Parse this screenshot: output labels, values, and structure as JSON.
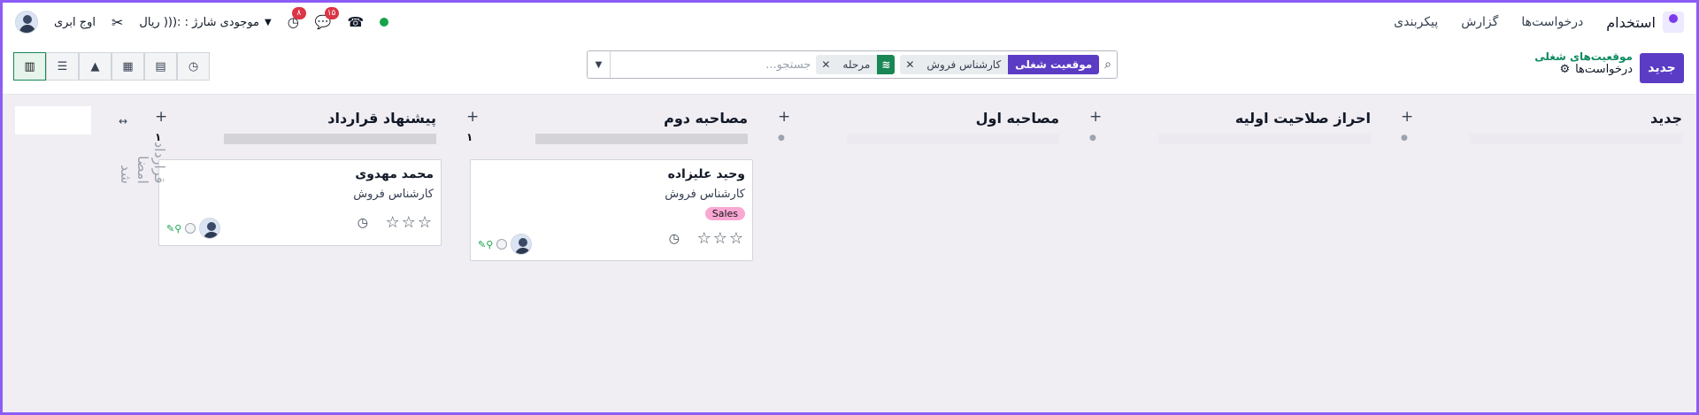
{
  "nav": {
    "app_name": "استخدام",
    "menu": [
      "درخواست‌ها",
      "گزارش",
      "پیکربندی"
    ],
    "user_name": "اوج ابری",
    "credit_label": "موجودی شارژ : :((( ریال",
    "activity_badge": "۸",
    "messages_badge": "۱۵",
    "status_color": "#16a34a"
  },
  "control": {
    "new_button": "جدید",
    "breadcrumb_parent": "موقعیت‌های شغلی",
    "breadcrumb_current": "درخواست‌ها",
    "search": {
      "placeholder": "جستجو...",
      "facets": [
        {
          "label": "موقعیت شغلی",
          "value": "کارشناس فروش"
        },
        {
          "label": "stack-icon",
          "value": "مرحله"
        }
      ]
    },
    "views": [
      "kanban",
      "list",
      "graph",
      "calendar",
      "pivot",
      "activity"
    ]
  },
  "columns": [
    {
      "title": "جدید",
      "count": "0"
    },
    {
      "title": "احراز صلاحیت اولیه",
      "count": "0"
    },
    {
      "title": "مصاحبه اول",
      "count": "0"
    },
    {
      "title": "مصاحبه دوم",
      "count": "۱"
    },
    {
      "title": "پیشنهاد قرارداد",
      "count": "۱"
    }
  ],
  "folded_column": "قرارداد امضا شد",
  "cards": [
    {
      "name": "وحید علیزاده",
      "job": "کارشناس فروش",
      "tag": "Sales",
      "stars": "☆☆☆"
    },
    {
      "name": "محمد مهدوی",
      "job": "کارشناس فروش",
      "stars": "☆☆☆"
    }
  ]
}
